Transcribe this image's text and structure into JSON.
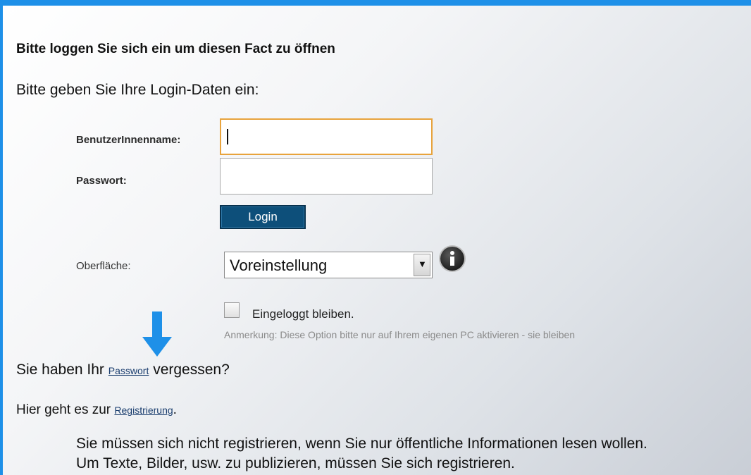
{
  "page": {
    "heading": "Bitte loggen Sie sich ein um diesen Fact zu öffnen",
    "intro": "Bitte geben Sie Ihre Login-Daten ein:"
  },
  "form": {
    "username_label": "BenutzerInnenname:",
    "username_value": "",
    "password_label": "Passwort:",
    "password_value": "",
    "login_button": "Login",
    "interface_label": "Oberfläche:",
    "interface_selected": "Voreinstellung",
    "info_icon": "info-icon",
    "remember_label": "Eingeloggt bleiben.",
    "remember_checked": false,
    "remember_note": "Anmerkung: Diese Option bitte nur auf Ihrem eigenen PC aktivieren - sie bleiben"
  },
  "links": {
    "forgot_pre": "Sie haben Ihr",
    "forgot_link": "Passwort",
    "forgot_post": "vergessen?",
    "register_pre": "Hier geht es zur",
    "register_link": "Registrierung",
    "register_post": "."
  },
  "info": {
    "line1": "Sie müssen sich nicht registrieren, wenn Sie nur öffentliche Informationen lesen wollen.",
    "line2": "Um Texte, Bilder, usw. zu publizieren, müssen Sie sich registrieren."
  },
  "colors": {
    "frame_accent": "#1e90e8",
    "button_bg": "#0d4f7a",
    "focus_border": "#e8a33c",
    "arrow": "#1e90e8"
  }
}
